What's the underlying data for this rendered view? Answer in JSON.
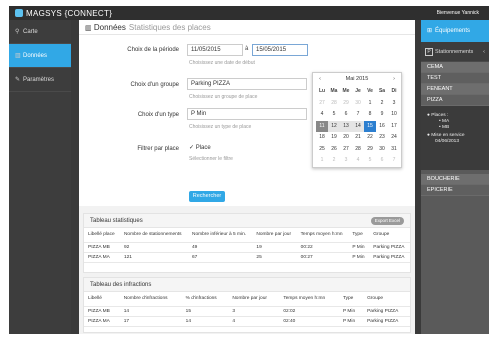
{
  "app": {
    "brand": "MAGSYS",
    "brand_suffix": "{CONNECT}",
    "user": "Bienvenue Yannick"
  },
  "leftnav": {
    "items": [
      {
        "icon": "map-marker-icon",
        "glyph": "⚲",
        "label": "Carte"
      },
      {
        "icon": "chart-icon",
        "glyph": "▥",
        "label": "Données",
        "active": true
      },
      {
        "icon": "wrench-icon",
        "glyph": "✎",
        "label": "Paramètres"
      }
    ]
  },
  "header": {
    "title": "Données",
    "subtitle": "Statistiques des places"
  },
  "form": {
    "period_label": "Choix de la période",
    "date_start": "11/05/2015",
    "date_sep": "à",
    "date_end": "15/05/2015",
    "period_help": "Choisissez une date de début",
    "group_label": "Choix d'un groupe",
    "group_value": "Parking PIZZA",
    "group_help": "Choisissez un groupe de place",
    "type_label": "Choix d'un type",
    "type_value": "P Min",
    "type_help": "Choisissez un type de place",
    "filter_label": "Filtrer par place",
    "filter_value": "Place",
    "filter_help": "Sélectionner le filtre",
    "search_button": "Rechercher"
  },
  "calendar": {
    "prev": "‹",
    "next": "›",
    "month": "Mai 2015",
    "dows": [
      "Lu",
      "Ma",
      "Me",
      "Je",
      "Ve",
      "Sa",
      "Di"
    ],
    "weeks": [
      [
        "27",
        "28",
        "29",
        "30",
        "1",
        "2",
        "3"
      ],
      [
        "4",
        "5",
        "6",
        "7",
        "8",
        "9",
        "10"
      ],
      [
        "11",
        "12",
        "13",
        "14",
        "15",
        "16",
        "17"
      ],
      [
        "18",
        "19",
        "20",
        "21",
        "22",
        "23",
        "24"
      ],
      [
        "25",
        "26",
        "27",
        "28",
        "29",
        "30",
        "31"
      ],
      [
        "1",
        "2",
        "3",
        "4",
        "5",
        "6",
        "7"
      ]
    ],
    "range_start": "11",
    "range_end": "15"
  },
  "stats_table": {
    "title": "Tableau statistiques",
    "export_label": "Export Excel",
    "headers": [
      "Libellé place",
      "Nombre de stationnements",
      "Nombre inférieur à 5 min.",
      "Nombre par jour",
      "Temps moyen h:mn",
      "Type",
      "Groupe"
    ],
    "rows": [
      [
        "PIZZA MB",
        "92",
        "49",
        "19",
        "00:22",
        "P Min",
        "Parking PIZZA"
      ],
      [
        "PIZZA MA",
        "121",
        "67",
        "25",
        "00:27",
        "P Min",
        "Parking PIZZA"
      ]
    ]
  },
  "infractions_table": {
    "title": "Tableau des infractions",
    "headers": [
      "Libellé",
      "Nombre d'infractions",
      "% d'infractions",
      "Nombre par jour",
      "Temps moyen h:mn",
      "Type",
      "Groupe"
    ],
    "rows": [
      [
        "PIZZA MB",
        "14",
        "15",
        "3",
        "02:02",
        "P Min",
        "Parking PIZZA"
      ],
      [
        "PIZZA MA",
        "17",
        "14",
        "4",
        "02:40",
        "P Min",
        "Parking PIZZA"
      ]
    ]
  },
  "rightnav": {
    "equipments": "Équipements",
    "stations": "Stationnements",
    "stations_icon": "P",
    "items": [
      "CEMA",
      "TEST",
      "FENEANT",
      "PIZZA"
    ],
    "detail": {
      "places_label": "Places :",
      "place_1": "MA",
      "place_2": "MB",
      "service_label": "Mise en service",
      "service_date": "04/06/2013"
    },
    "items_after": [
      "BOUCHERIE",
      "EPICERIE"
    ]
  }
}
